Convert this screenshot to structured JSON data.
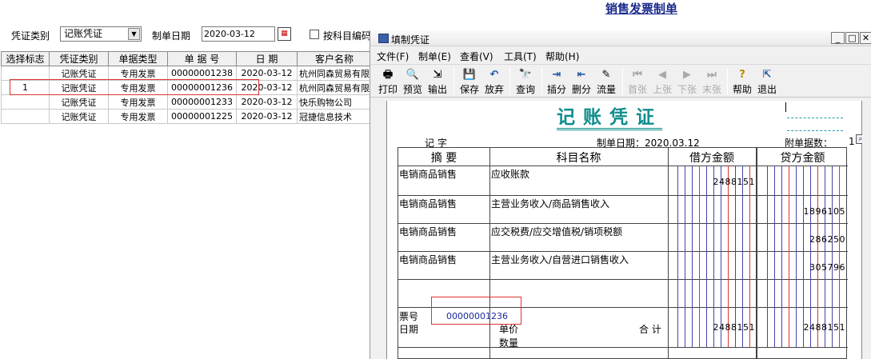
{
  "bg_title": "销售发票制单",
  "filter": {
    "voucher_type_label": "凭证类别",
    "voucher_type_value": "记账凭证",
    "date_label": "制单日期",
    "date_value": "2020-03-12",
    "merge_label": "按科目编码"
  },
  "list": {
    "headers": [
      "选择标志",
      "凭证类别",
      "单据类型",
      "单 据 号",
      "日 期",
      "客户名称"
    ],
    "rows": [
      {
        "flag": "",
        "type": "记账凭证",
        "doc_type": "专用发票",
        "doc_no": "00000001238",
        "date": "2020-03-12",
        "customer": "杭州同森贸易有限"
      },
      {
        "flag": "1",
        "type": "记账凭证",
        "doc_type": "专用发票",
        "doc_no": "00000001236",
        "date": "2020-03-12",
        "customer": "杭州同森贸易有限"
      },
      {
        "flag": "",
        "type": "记账凭证",
        "doc_type": "专用发票",
        "doc_no": "00000001233",
        "date": "2020-03-12",
        "customer": "快乐购物公司"
      },
      {
        "flag": "",
        "type": "记账凭证",
        "doc_type": "专用发票",
        "doc_no": "00000001225",
        "date": "2020-03-12",
        "customer": "冠捷信息技术"
      }
    ]
  },
  "dialog": {
    "title": "填制凭证",
    "menu": [
      "文件(F)",
      "制单(E)",
      "查看(V)",
      "工具(T)",
      "帮助(H)"
    ],
    "toolbar": [
      {
        "label": "打印",
        "icon": "🖶"
      },
      {
        "label": "预览",
        "icon": "🔍"
      },
      {
        "label": "输出",
        "icon": "⇲"
      },
      {
        "label": "保存",
        "icon": "💾"
      },
      {
        "label": "放弃",
        "icon": "↶"
      },
      {
        "label": "查询",
        "icon": "🔭"
      },
      {
        "label": "插分",
        "icon": "⇥"
      },
      {
        "label": "删分",
        "icon": "⇤"
      },
      {
        "label": "流量",
        "icon": "✎"
      },
      {
        "label": "首张",
        "icon": "⏮"
      },
      {
        "label": "上张",
        "icon": "◀"
      },
      {
        "label": "下张",
        "icon": "▶"
      },
      {
        "label": "末张",
        "icon": "⏭"
      },
      {
        "label": "帮助",
        "icon": "?"
      },
      {
        "label": "退出",
        "icon": "⇱"
      }
    ],
    "voucher": {
      "title": "记账凭证",
      "word_label": "记      字",
      "date_label": "制单日期：2020.03.12",
      "attach_label": "附单据数：",
      "attach_value": "1",
      "col_summary": "摘 要",
      "col_account": "科目名称",
      "col_debit": "借方金额",
      "col_credit": "贷方金额",
      "entries": [
        {
          "summary": "电销商品销售",
          "account": "应收账款",
          "debit": "2488151",
          "credit": ""
        },
        {
          "summary": "电销商品销售",
          "account": "主营业务收入/商品销售收入",
          "debit": "",
          "credit": "1896105"
        },
        {
          "summary": "电销商品销售",
          "account": "应交税费/应交增值税/销项税额",
          "debit": "",
          "credit": "286250"
        },
        {
          "summary": "电销商品销售",
          "account": "主营业务收入/自营进口销售收入",
          "debit": "",
          "credit": "305796"
        }
      ],
      "bill_no_label": "票号",
      "bill_no_value": "00000001236",
      "date_row_label": "日期",
      "price_label": "单价",
      "qty_label": "数量",
      "total_label": "合 计",
      "total_debit": "2488151",
      "total_credit": "2488151"
    }
  }
}
